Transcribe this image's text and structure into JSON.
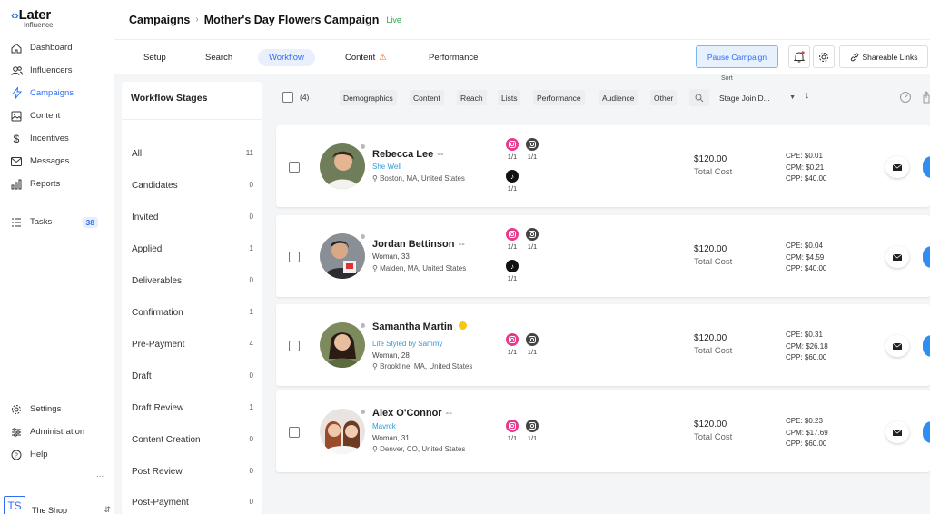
{
  "logo": {
    "brand": "Later",
    "sub": "Influence"
  },
  "sidebar": {
    "items": [
      {
        "label": "Dashboard",
        "icon": "home-icon"
      },
      {
        "label": "Influencers",
        "icon": "users-icon"
      },
      {
        "label": "Campaigns",
        "icon": "bolt-icon",
        "active": true
      },
      {
        "label": "Content",
        "icon": "image-icon"
      },
      {
        "label": "Incentives",
        "icon": "dollar-icon"
      },
      {
        "label": "Messages",
        "icon": "mail-icon"
      },
      {
        "label": "Reports",
        "icon": "bar-chart-icon"
      }
    ],
    "tasks": {
      "label": "Tasks",
      "count": "38"
    },
    "bottom": [
      {
        "label": "Settings",
        "icon": "gear-icon"
      },
      {
        "label": "Administration",
        "icon": "sliders-icon"
      },
      {
        "label": "Help",
        "icon": "help-icon"
      }
    ],
    "more": "...",
    "shop": {
      "initials": "TS",
      "name": "The Shop"
    }
  },
  "header": {
    "section": "Campaigns",
    "separator": "›",
    "campaign": "Mother's Day Flowers Campaign",
    "status": "Live"
  },
  "tabs": [
    {
      "label": "Setup"
    },
    {
      "label": "Search"
    },
    {
      "label": "Workflow",
      "active": true
    },
    {
      "label": "Content",
      "warning": true
    },
    {
      "label": "Performance"
    }
  ],
  "actions": {
    "pause": "Pause Campaign",
    "share": "Shareable Links"
  },
  "stages": {
    "title": "Workflow Stages",
    "items": [
      {
        "label": "All",
        "count": "11"
      },
      {
        "label": "Candidates",
        "count": "0"
      },
      {
        "label": "Invited",
        "count": "0"
      },
      {
        "label": "Applied",
        "count": "1"
      },
      {
        "label": "Deliverables",
        "count": "0"
      },
      {
        "label": "Confirmation",
        "count": "1"
      },
      {
        "label": "Pre-Payment",
        "count": "4"
      },
      {
        "label": "Draft",
        "count": "0"
      },
      {
        "label": "Draft Review",
        "count": "1"
      },
      {
        "label": "Content Creation",
        "count": "0"
      },
      {
        "label": "Post Review",
        "count": "0"
      },
      {
        "label": "Post-Payment",
        "count": "0"
      }
    ]
  },
  "filters": {
    "selected_count": "(4)",
    "chips": [
      "Demographics",
      "Content",
      "Reach",
      "Lists",
      "Performance",
      "Audience",
      "Other"
    ],
    "sort_label": "Sort",
    "sort_value": "Stage Join D..."
  },
  "influencers": [
    {
      "name": "Rebecca Lee",
      "more": "--",
      "handle": "She Well",
      "demo": "",
      "location": "Boston, MA, United States",
      "socials": [
        {
          "type": "instagram",
          "count": "1/1"
        },
        {
          "type": "instagram-gray",
          "count": "1/1"
        },
        {
          "type": "tiktok",
          "count": "1/1"
        }
      ],
      "cost": "$120.00",
      "cost_label": "Total Cost",
      "cpe": "CPE: $0.01",
      "cpm": "CPM: $0.21",
      "cpp": "CPP: $40.00"
    },
    {
      "name": "Jordan Bettinson",
      "more": "--",
      "handle": "",
      "demo": "Woman, 33",
      "location": "Malden, MA, United States",
      "socials": [
        {
          "type": "instagram",
          "count": "1/1"
        },
        {
          "type": "instagram-gray",
          "count": "1/1"
        },
        {
          "type": "tiktok",
          "count": "1/1"
        }
      ],
      "cost": "$120.00",
      "cost_label": "Total Cost",
      "cpe": "CPE: $0.04",
      "cpm": "CPM: $4.59",
      "cpp": "CPP: $40.00"
    },
    {
      "name": "Samantha Martin",
      "more": "",
      "verified": true,
      "handle": "Life Styled by Sammy",
      "demo": "Woman, 28",
      "location": "Brookline, MA, United States",
      "socials": [
        {
          "type": "instagram",
          "count": "1/1"
        },
        {
          "type": "instagram-gray",
          "count": "1/1"
        }
      ],
      "cost": "$120.00",
      "cost_label": "Total Cost",
      "cpe": "CPE: $0.31",
      "cpm": "CPM: $26.18",
      "cpp": "CPP: $60.00"
    },
    {
      "name": "Alex O'Connor",
      "more": "--",
      "handle": "Mavrck",
      "demo": "Woman, 31",
      "location": "Denver, CO, United States",
      "socials": [
        {
          "type": "instagram",
          "count": "1/1"
        },
        {
          "type": "instagram-gray",
          "count": "1/1"
        }
      ],
      "cost": "$120.00",
      "cost_label": "Total Cost",
      "cpe": "CPE: $0.23",
      "cpm": "CPM: $17.69",
      "cpp": "CPP: $60.00"
    }
  ],
  "colors": {
    "accent": "#2f6df6",
    "live": "#2fa84f",
    "instagram": "#e8398d",
    "handle": "#2f9cd6"
  }
}
